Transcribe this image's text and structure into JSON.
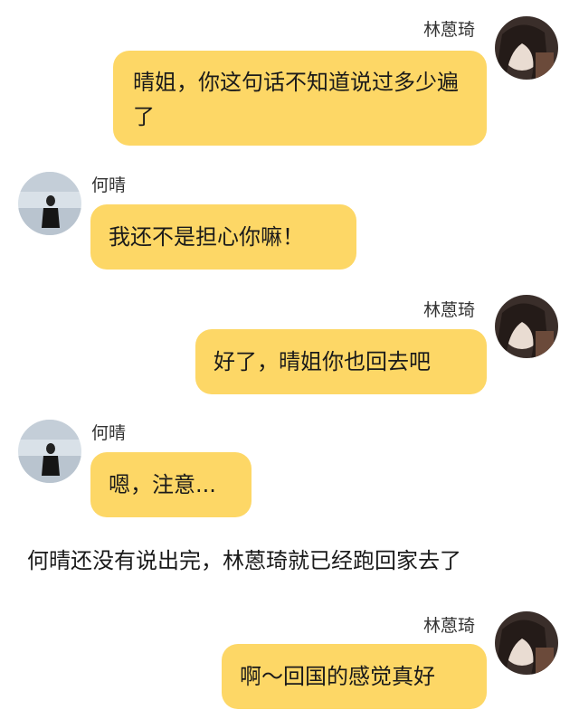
{
  "messages": [
    {
      "sender": "林蒽琦",
      "text": "晴姐，你这句话不知道说过多少遍了",
      "side": "right"
    },
    {
      "sender": "何晴",
      "text": "我还不是担心你嘛！",
      "side": "left"
    },
    {
      "sender": "林蒽琦",
      "text": "好了，晴姐你也回去吧",
      "side": "right"
    },
    {
      "sender": "何晴",
      "text": "嗯，注意...",
      "side": "left"
    },
    {
      "sender": "林蒽琦",
      "text": "啊～回国的感觉真好",
      "side": "right"
    }
  ],
  "narration": "何晴还没有说出完，林蒽琦就已经跑回家去了",
  "colors": {
    "bubble": "#fdd766",
    "background": "#ffffff"
  },
  "icons": {
    "right_avatar": "avatar-photo-dark",
    "left_avatar": "avatar-photo-light"
  }
}
